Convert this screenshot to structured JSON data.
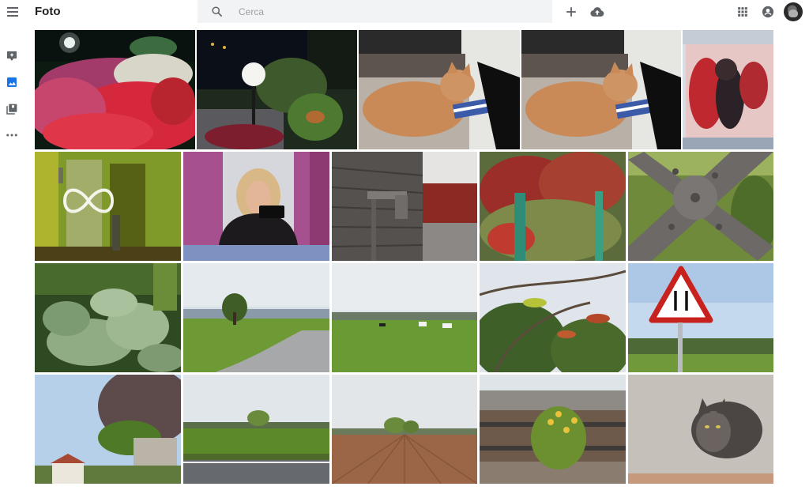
{
  "app": {
    "title": "Foto"
  },
  "search": {
    "placeholder": "Cerca"
  },
  "toolbar": {
    "icons": [
      "menu-icon",
      "search-icon",
      "plus-icon",
      "cloud-upload-icon",
      "apps-grid-icon",
      "account-circle-icon",
      "avatar"
    ]
  },
  "rail": {
    "items": [
      {
        "name": "assistant-icon",
        "active": false
      },
      {
        "name": "photos-icon",
        "active": true
      },
      {
        "name": "albums-icon",
        "active": false
      },
      {
        "name": "more-icon",
        "active": false
      }
    ]
  },
  "colors": {
    "accent": "#1a73e8",
    "icon_gray": "#5f6368",
    "search_bg": "#f1f3f4"
  },
  "photos": [
    {
      "name": "photo-garden-flowers-night"
    },
    {
      "name": "photo-garden-lamp-night"
    },
    {
      "name": "photo-cat-sleeping-chair"
    },
    {
      "name": "photo-cat-sleeping-chair-2"
    },
    {
      "name": "photo-monitor-figure"
    },
    {
      "name": "photo-light-painting-infinity"
    },
    {
      "name": "photo-selfie-mirror"
    },
    {
      "name": "photo-water-tap-wall"
    },
    {
      "name": "photo-red-maple-leaves"
    },
    {
      "name": "photo-rusty-metal-cross"
    },
    {
      "name": "photo-sage-plant"
    },
    {
      "name": "photo-country-road-tree"
    },
    {
      "name": "photo-green-field-cows"
    },
    {
      "name": "photo-branches-leaves"
    },
    {
      "name": "photo-road-sign-narrowing"
    },
    {
      "name": "photo-tree-villa"
    },
    {
      "name": "photo-grass-field-road"
    },
    {
      "name": "photo-plowed-field"
    },
    {
      "name": "photo-railway-flowers"
    },
    {
      "name": "photo-cat-top-view"
    }
  ]
}
